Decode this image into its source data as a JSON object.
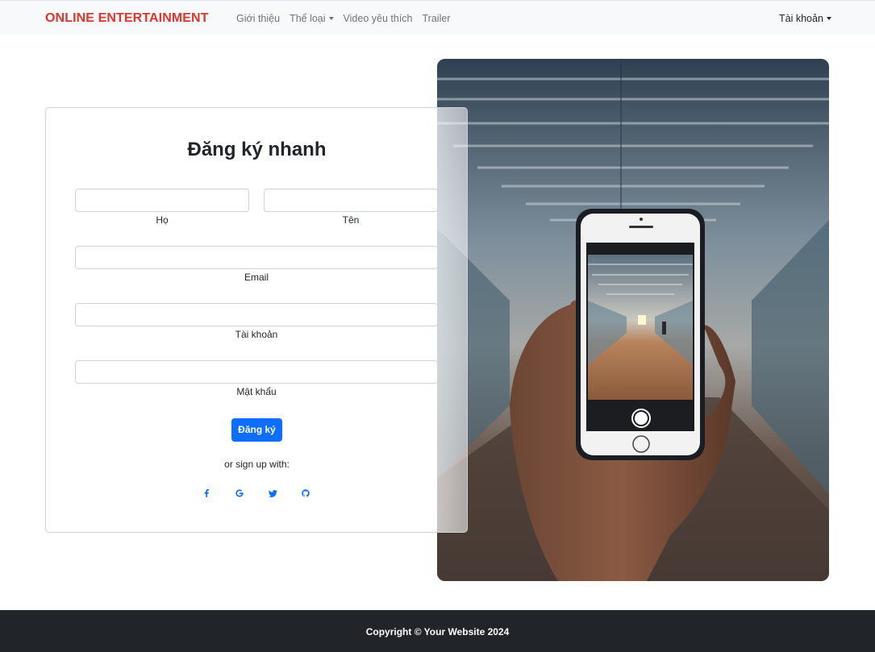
{
  "navbar": {
    "brand": "ONLINE ENTERTAINMENT",
    "links": [
      {
        "label": "Giới thiệu",
        "dropdown": false
      },
      {
        "label": "Thể loại",
        "dropdown": true
      },
      {
        "label": "Video yêu thích",
        "dropdown": false
      },
      {
        "label": "Trailer",
        "dropdown": false
      }
    ],
    "account_label": "Tài khoản"
  },
  "form": {
    "title": "Đăng ký nhanh",
    "fields": {
      "last_name": {
        "label": "Họ",
        "value": ""
      },
      "first_name": {
        "label": "Tên",
        "value": ""
      },
      "email": {
        "label": "Email",
        "value": ""
      },
      "username": {
        "label": "Tài khoản",
        "value": ""
      },
      "password": {
        "label": "Mật khẩu",
        "value": ""
      }
    },
    "submit_label": "Đăng ký",
    "alt_signup_text": "or sign up with:",
    "social_icons": [
      "facebook-icon",
      "google-icon",
      "twitter-icon",
      "github-icon"
    ]
  },
  "footer": {
    "copyright": "Copyright © Your Website 2024"
  },
  "colors": {
    "brand": "#e0342c",
    "primary": "#0d6efd",
    "footer_bg": "#212529",
    "navbar_bg": "#f8f9fa"
  }
}
